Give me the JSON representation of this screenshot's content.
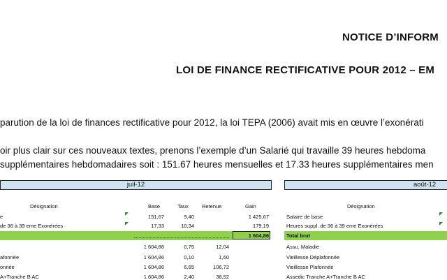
{
  "title_line1": "NOTICE D’INFORM",
  "title_line2": "LOI DE FINANCE RECTIFICATIVE POUR 2012 – EM",
  "para1": "parution de la loi de finances rectificative pour 2012, la loi TEPA (2006) avait mis en œuvre l’exonérati",
  "para2a": "oir plus clair sur ces nouveaux textes, prenons l’exemple d’un Salarié qui travaille 39 heures hebdoma",
  "para2b": "supplémentaires hebdomadaires soit : 151.67 heures mensuelles et 17.33 heures supplémentaires men",
  "left_table": {
    "month": "juil-12",
    "headers": {
      "designation": "Désignation",
      "base": "Base",
      "taux": "Taux",
      "retenue": "Retenue",
      "gain": "Gain"
    },
    "rows": [
      {
        "designation": "e",
        "base": "151,67",
        "taux": "9,40",
        "retenue": "",
        "gain": "1 425,67"
      },
      {
        "designation": "de 36 à 39 eme Exonérées",
        "base": "17,33",
        "taux": "10,34",
        "retenue": "",
        "gain": "179,19"
      },
      {
        "designation": "",
        "base": "",
        "taux": "",
        "retenue": "",
        "gain": "1 604,86"
      },
      {
        "designation": "",
        "base": "1 604,86",
        "taux": "0,75",
        "retenue": "12,04",
        "gain": ""
      },
      {
        "designation": "afonnée",
        "base": "1 604,86",
        "taux": "0,10",
        "retenue": "1,60",
        "gain": ""
      },
      {
        "designation": "onnée",
        "base": "1 604,86",
        "taux": "6,65",
        "retenue": "106,72",
        "gain": ""
      },
      {
        "designation": "A+Tranche B AC",
        "base": "1 604,86",
        "taux": "2,40",
        "retenue": "38,52",
        "gain": ""
      }
    ]
  },
  "right_table": {
    "month": "août-12",
    "headers": {
      "designation": "Désignation"
    },
    "rows": [
      {
        "designation": "Salaire de base"
      },
      {
        "designation": "Heures suppl. de 36 à 39 eme Exonérées"
      },
      {
        "designation": "Total brut"
      },
      {
        "designation": "Assu. Maladie"
      },
      {
        "designation": "Vieillesse Déplafonnée"
      },
      {
        "designation": "Vieillesse Plafonnée"
      },
      {
        "designation": "Assedic Tranche A+Tranche B AC"
      }
    ]
  },
  "colors": {
    "band": "#cfe2ef",
    "total_green": "#8fd14a",
    "marker": "#2e8b2e"
  }
}
